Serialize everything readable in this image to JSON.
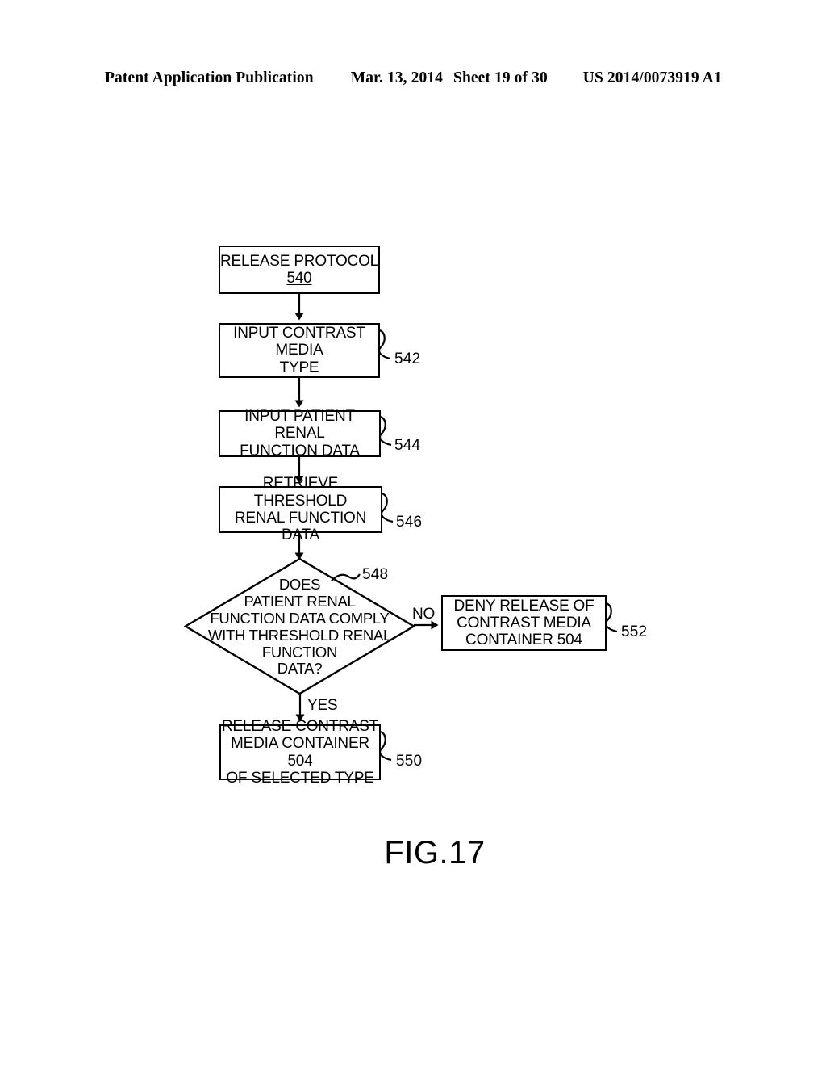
{
  "header": {
    "title": "Patent Application Publication",
    "date": "Mar. 13, 2014",
    "sheet": "Sheet 19 of 30",
    "publication_number": "US 2014/0073919 A1"
  },
  "figure": {
    "caption": "FIG.17",
    "nodes": {
      "n540": {
        "label": "RELEASE PROTOCOL",
        "ref": "540",
        "shape": "process"
      },
      "n542": {
        "label": "INPUT CONTRAST MEDIA\nTYPE",
        "ref": "542",
        "shape": "process"
      },
      "n544": {
        "label": "INPUT PATIENT RENAL\nFUNCTION DATA",
        "ref": "544",
        "shape": "process"
      },
      "n546": {
        "label": "RETRIEVE THRESHOLD\nRENAL FUNCTION DATA",
        "ref": "546",
        "shape": "process"
      },
      "n548": {
        "label": "DOES\nPATIENT RENAL\nFUNCTION DATA COMPLY\nWITH THRESHOLD RENAL\nFUNCTION\nDATA?",
        "ref": "548",
        "shape": "decision"
      },
      "n550": {
        "label": "RELEASE CONTRAST\nMEDIA CONTAINER 504\nOF SELECTED TYPE",
        "ref": "550",
        "shape": "process"
      },
      "n552": {
        "label": "DENY RELEASE OF\nCONTRAST MEDIA\nCONTAINER 504",
        "ref": "552",
        "shape": "process"
      }
    },
    "branches": {
      "no": "NO",
      "yes": "YES"
    }
  },
  "colors": {
    "ink": "#000000",
    "page": "#ffffff"
  }
}
